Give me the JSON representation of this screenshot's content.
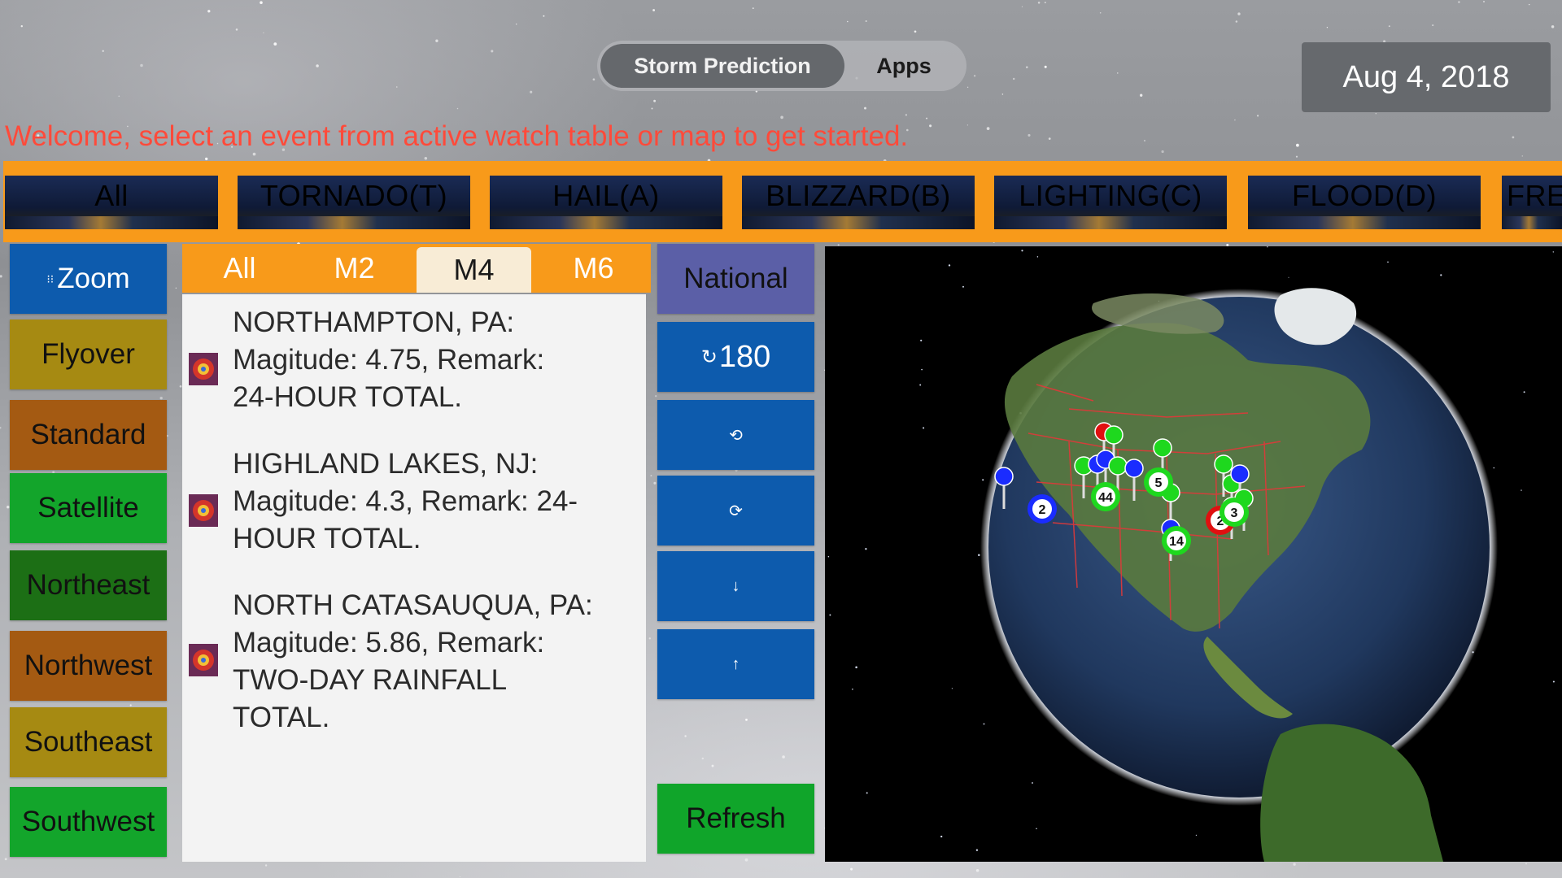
{
  "header": {
    "segments": [
      {
        "label": "Storm Prediction",
        "active": true
      },
      {
        "label": "Apps",
        "active": false
      }
    ],
    "date": "Aug 4, 2018",
    "welcome": "Welcome, select an event from active watch table or map to get started."
  },
  "categories": [
    {
      "label": "All",
      "active": true
    },
    {
      "label": "TORNADO(T)",
      "active": true
    },
    {
      "label": "HAIL(A)",
      "active": false
    },
    {
      "label": "BLIZZARD(B)",
      "active": false
    },
    {
      "label": "LIGHTING(C)",
      "active": false
    },
    {
      "label": "FLOOD(D)",
      "active": false
    },
    {
      "label": "FRE",
      "active": true
    }
  ],
  "left_buttons": [
    {
      "label": "Zoom",
      "color": "#0d5bad"
    },
    {
      "label": "Flyover",
      "color": "#a68a12"
    },
    {
      "label": "Standard",
      "color": "#a45a12"
    },
    {
      "label": "Satellite",
      "color": "#13a52b"
    },
    {
      "label": "Northeast",
      "color": "#1c6f15"
    },
    {
      "label": "Northwest",
      "color": "#a45a12"
    },
    {
      "label": "Southeast",
      "color": "#a68a12"
    },
    {
      "label": "Southwest",
      "color": "#13a52b"
    }
  ],
  "filters": [
    {
      "label": "All",
      "active": false
    },
    {
      "label": "M2",
      "active": false
    },
    {
      "label": "M4",
      "active": true
    },
    {
      "label": "M6",
      "active": false
    }
  ],
  "events": [
    {
      "lines": [
        "NORTHAMPTON, PA:",
        "Magitude: 4.75, Remark:",
        "24-HOUR TOTAL."
      ]
    },
    {
      "lines": [
        "HIGHLAND LAKES, NJ:",
        "Magitude: 4.3, Remark: 24-",
        "HOUR TOTAL."
      ]
    },
    {
      "lines": [
        "NORTH CATASAUQUA, PA:",
        "Magitude: 5.86, Remark:",
        "TWO-DAY RAINFALL",
        "TOTAL."
      ]
    }
  ],
  "mid_buttons": {
    "national": "National",
    "rotate_label": "180",
    "rotate_icon": "↻",
    "rotate_ccw_icon": "⟲",
    "rotate_cw_icon": "⟳",
    "down_icon": "↓",
    "up_icon": "↑",
    "refresh": "Refresh"
  },
  "map_pins": [
    {
      "count": "2",
      "color": "#1a2cff"
    },
    {
      "count": "44",
      "color": "#1ed81e"
    },
    {
      "count": "5",
      "color": "#1ed81e"
    },
    {
      "count": "14",
      "color": "#1ed81e"
    },
    {
      "count": "2",
      "color": "#e01010"
    },
    {
      "count": "3",
      "color": "#1ed81e"
    }
  ],
  "colors": {
    "accent_orange": "#f89a1a",
    "welcome_red": "#ff4a3a",
    "active_blue": "#0b7df7",
    "button_blue": "#0d5bad",
    "national_purple": "#5b5fa7",
    "refresh_green": "#10a52a"
  }
}
